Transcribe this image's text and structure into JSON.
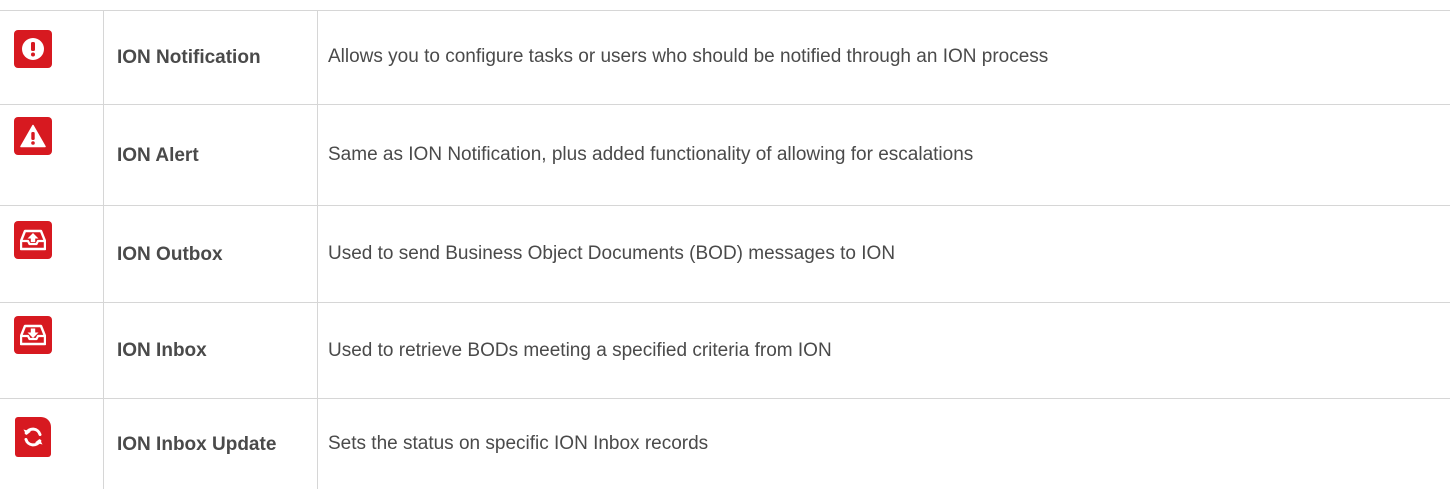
{
  "rows": [
    {
      "name": "ION Notification",
      "description": "Allows you to configure tasks or users who should be notified through an ION process",
      "icon": "exclamation-circle-icon"
    },
    {
      "name": "ION Alert",
      "description": "Same as ION Notification, plus added functionality of allowing for escalations",
      "icon": "warning-triangle-icon"
    },
    {
      "name": "ION Outbox",
      "description": "Used to send Business Object Documents (BOD) messages to ION",
      "icon": "outbox-icon"
    },
    {
      "name": "ION Inbox",
      "description": "Used to retrieve BODs meeting a specified criteria from ION",
      "icon": "inbox-icon"
    },
    {
      "name": "ION Inbox Update",
      "description": "Sets the status on specific ION Inbox records",
      "icon": "refresh-document-icon"
    }
  ],
  "colors": {
    "accent": "#d71920",
    "border": "#d6d6d6",
    "text": "#4a4a4a"
  }
}
